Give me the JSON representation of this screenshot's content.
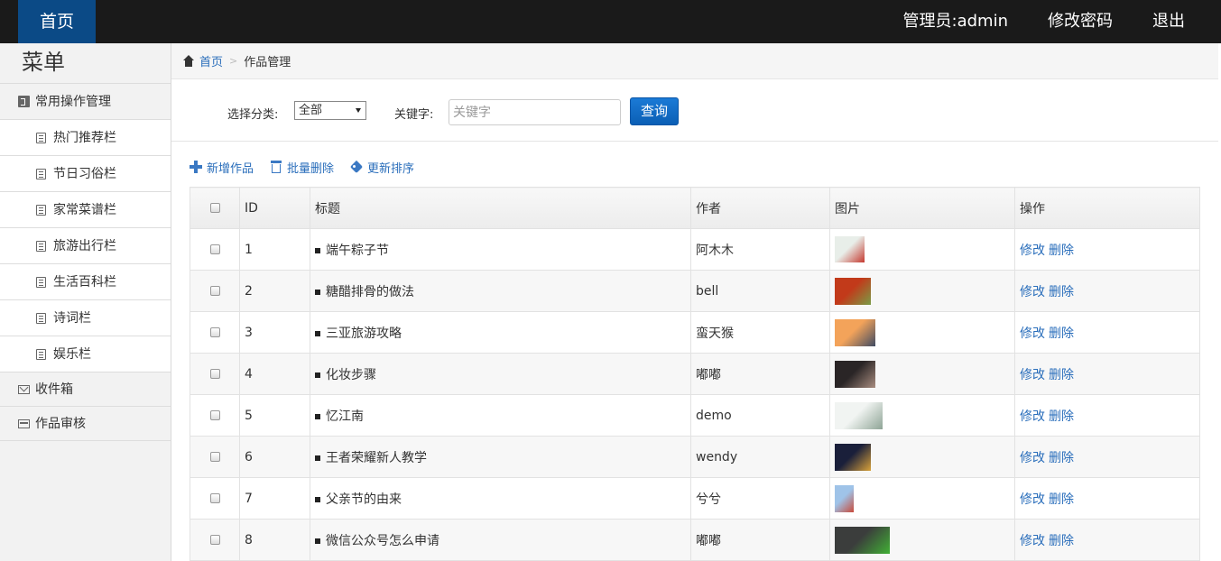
{
  "header": {
    "home_tab": "首页",
    "admin_label": "管理员:admin",
    "change_password": "修改密码",
    "logout": "退出"
  },
  "sidebar": {
    "title": "菜单",
    "group_common": "常用操作管理",
    "items": [
      "热门推荐栏",
      "节日习俗栏",
      "家常菜谱栏",
      "旅游出行栏",
      "生活百科栏",
      "诗词栏",
      "娱乐栏"
    ],
    "inbox": "收件箱",
    "review": "作品审核"
  },
  "breadcrumb": {
    "home": "首页",
    "current": "作品管理"
  },
  "search": {
    "category_label": "选择分类:",
    "category_value": "全部",
    "keyword_label": "关键字:",
    "keyword_placeholder": "关键字",
    "search_button": "查询"
  },
  "toolbar": {
    "add": "新增作品",
    "batch_delete": "批量删除",
    "update_sort": "更新排序"
  },
  "table": {
    "headers": {
      "id": "ID",
      "title": "标题",
      "author": "作者",
      "image": "图片",
      "ops": "操作"
    },
    "rows": [
      {
        "id": "1",
        "title": "端午粽子节",
        "author": "阿木木",
        "thumb_colors": [
          "#e8eee9",
          "#c5392f"
        ]
      },
      {
        "id": "2",
        "title": "糖醋排骨的做法",
        "author": "bell",
        "thumb_colors": [
          "#c23a1a",
          "#7a9c46"
        ]
      },
      {
        "id": "3",
        "title": "三亚旅游攻略",
        "author": "蛮天猴",
        "thumb_colors": [
          "#f3a35a",
          "#3f4b63"
        ]
      },
      {
        "id": "4",
        "title": "化妆步骤",
        "author": "嘟嘟",
        "thumb_colors": [
          "#2a2526",
          "#a98d80"
        ]
      },
      {
        "id": "5",
        "title": "忆江南",
        "author": "demo",
        "thumb_colors": [
          "#f1f4f2",
          "#8ea496"
        ]
      },
      {
        "id": "6",
        "title": "王者荣耀新人教学",
        "author": "wendy",
        "thumb_colors": [
          "#1a1f3a",
          "#d9a23a"
        ]
      },
      {
        "id": "7",
        "title": "父亲节的由来",
        "author": "兮兮",
        "thumb_colors": [
          "#9fc3e8",
          "#c84a3a"
        ]
      },
      {
        "id": "8",
        "title": "微信公众号怎么申请",
        "author": "嘟嘟",
        "thumb_colors": [
          "#3b3d3c",
          "#41b035"
        ]
      }
    ],
    "edit_label": "修改",
    "delete_label": "删除"
  }
}
